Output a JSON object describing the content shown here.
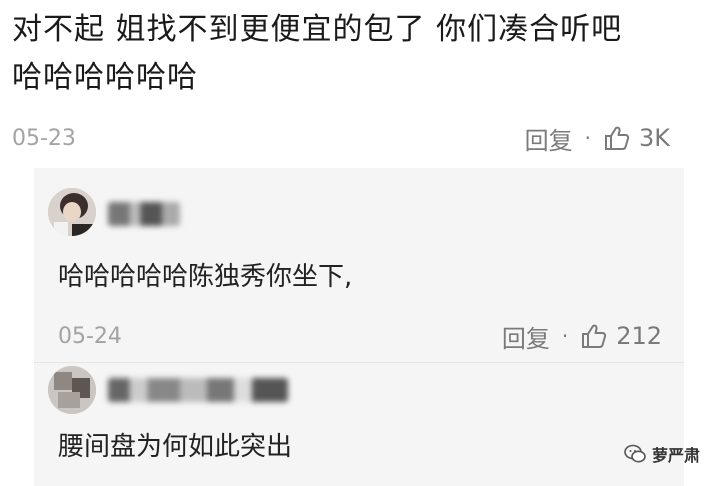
{
  "comment": {
    "line1": "对不起 姐找不到更便宜的包了 你们凑合听吧",
    "line2": "哈哈哈哈哈哈",
    "date": "05-23",
    "reply_label": "回复",
    "separator": "·",
    "like_count": "3K"
  },
  "replies": [
    {
      "text": "哈哈哈哈哈陈独秀你坐下,",
      "date": "05-24",
      "reply_label": "回复",
      "separator": "·",
      "like_count": "212"
    },
    {
      "text": "腰间盘为何如此突出"
    }
  ],
  "watermark": {
    "text": "萝严肃"
  },
  "icons": {
    "like": "thumbs-up-icon",
    "watermark": "wechat-icon"
  },
  "colors": {
    "background": "#ffffff",
    "reply_background": "#f5f5f5",
    "meta": "#8a8a8a"
  }
}
